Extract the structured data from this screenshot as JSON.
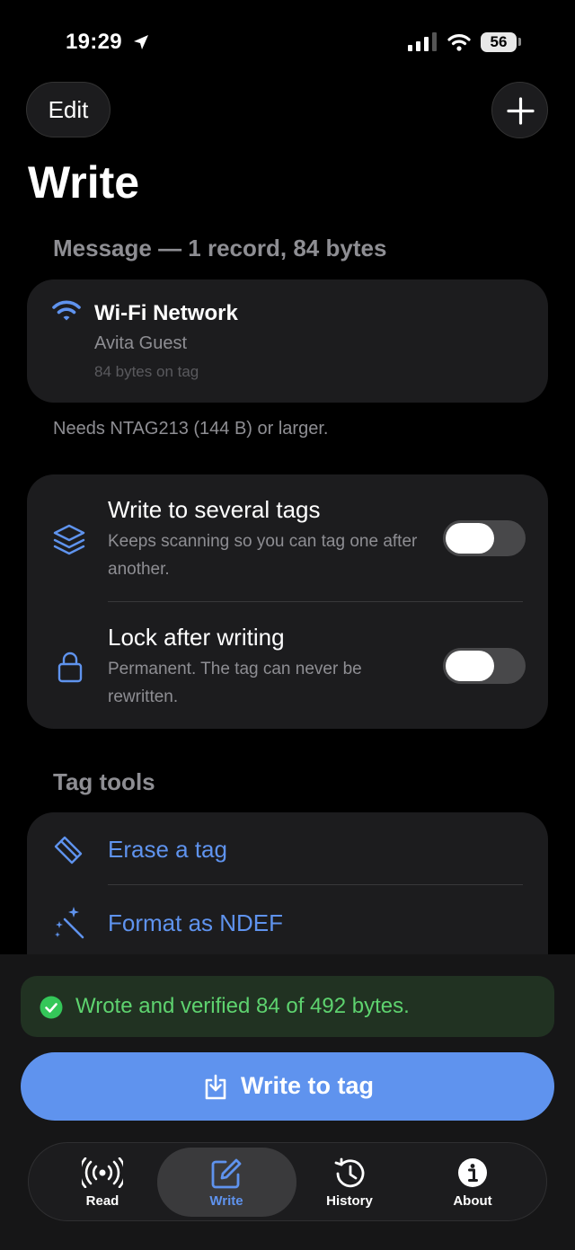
{
  "status_bar": {
    "time": "19:29",
    "battery": "56"
  },
  "header": {
    "edit_label": "Edit",
    "title": "Write"
  },
  "message": {
    "section_title": "Message — 1 record, 84 bytes",
    "record": {
      "title": "Wi-Fi Network",
      "subtitle": "Avita Guest",
      "size": "84 bytes on tag"
    },
    "requirement": "Needs NTAG213 (144 B) or larger."
  },
  "options": [
    {
      "title": "Write to several tags",
      "description": "Keeps scanning so you can tag one after another.",
      "enabled": false
    },
    {
      "title": "Lock after writing",
      "description": "Permanent. The tag can never be rewritten.",
      "enabled": false
    }
  ],
  "tools": {
    "section_title": "Tag tools",
    "items": [
      {
        "label": "Erase a tag",
        "icon": "eraser-icon"
      },
      {
        "label": "Format as NDEF",
        "icon": "magic-wand-icon"
      }
    ]
  },
  "toast": {
    "text": "Wrote and verified 84 of 492 bytes."
  },
  "primary_action": {
    "label": "Write to tag"
  },
  "tabs": [
    {
      "label": "Read",
      "icon": "radio-waves-icon",
      "active": false
    },
    {
      "label": "Write",
      "icon": "compose-icon",
      "active": true
    },
    {
      "label": "History",
      "icon": "history-clock-icon",
      "active": false
    },
    {
      "label": "About",
      "icon": "info-icon",
      "active": false
    }
  ],
  "colors": {
    "accent": "#5f93ee",
    "success": "#5ed36f",
    "card": "#1c1c1e",
    "background": "#000000"
  }
}
